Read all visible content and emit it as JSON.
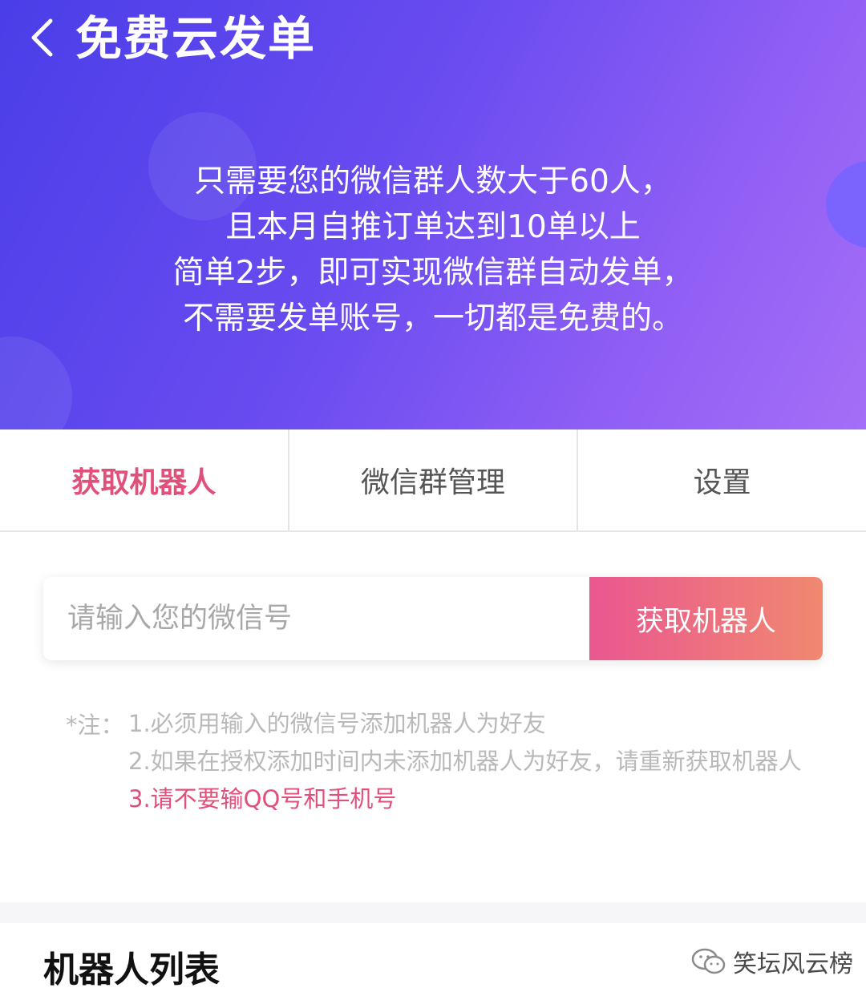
{
  "header": {
    "back_icon": "chevron-left-icon",
    "title": "免费云发单",
    "intro_lines": [
      "只需要您的微信群人数大于60人，",
      "且本月自推订单达到10单以上",
      "简单2步，即可实现微信群自动发单，",
      "不需要发单账号，一切都是免费的。"
    ]
  },
  "tabs": [
    {
      "label": "获取机器人",
      "active": true
    },
    {
      "label": "微信群管理",
      "active": false
    },
    {
      "label": "设置",
      "active": false
    }
  ],
  "form": {
    "input_value": "",
    "input_placeholder": "请输入您的微信号",
    "button_label": "获取机器人"
  },
  "notes": {
    "prefix": "*注：",
    "items": [
      "1.必须用输入的微信号添加机器人为好友",
      "2.如果在授权添加时间内未添加机器人为好友，请重新获取机器人",
      "3.请不要输QQ号和手机号"
    ]
  },
  "list": {
    "title": "机器人列表"
  },
  "watermark": {
    "icon": "wechat-icon",
    "text": "笑坛风云榜"
  },
  "colors": {
    "banner_start": "#4a3ee8",
    "banner_end": "#a56ef6",
    "accent": "#e0507a",
    "button_start": "#ea5790",
    "button_end": "#f08870"
  }
}
